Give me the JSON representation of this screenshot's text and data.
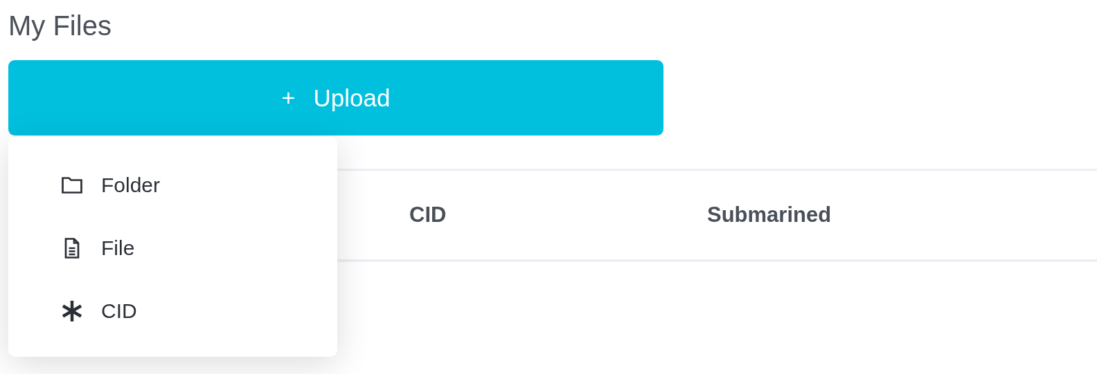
{
  "page": {
    "title": "My Files"
  },
  "upload_button": {
    "icon": "+",
    "label": "Upload"
  },
  "upload_menu": [
    {
      "kind": "folder",
      "label": "Folder"
    },
    {
      "kind": "file",
      "label": "File"
    },
    {
      "kind": "cid",
      "label": "CID"
    }
  ],
  "table": {
    "columns": [
      "CID",
      "Submarined"
    ]
  }
}
